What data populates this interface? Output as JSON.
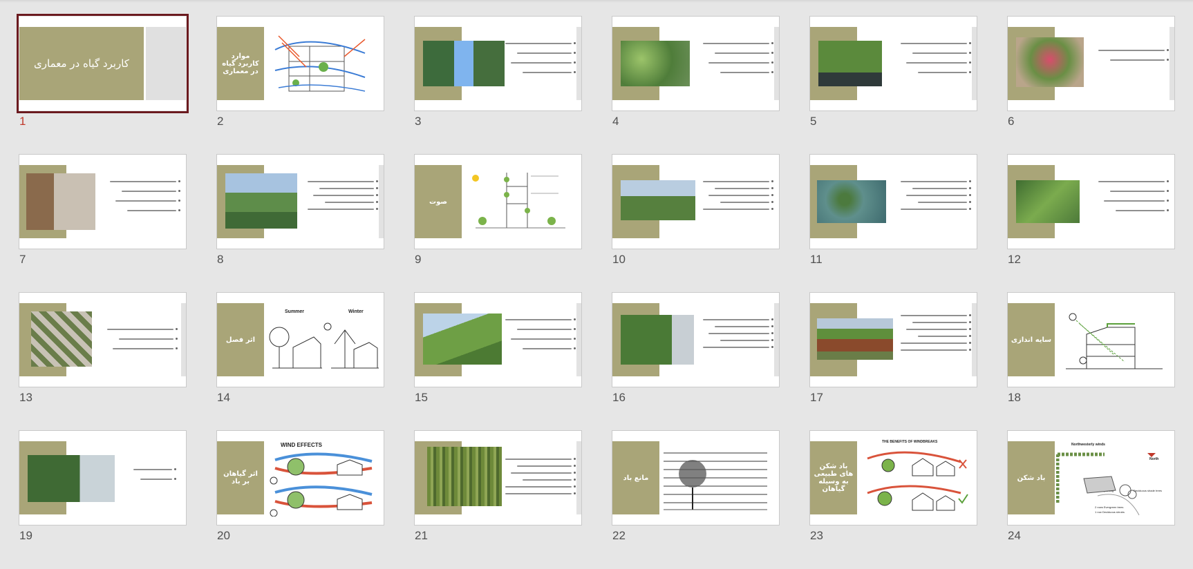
{
  "colors": {
    "olive": "#a9a578",
    "selection_border": "#6b1a1f",
    "selected_number": "#c0392b",
    "background": "#e6e6e6"
  },
  "selected_slide": 1,
  "slides": [
    {
      "number": "1",
      "title": "کاربرد گیاه در معماری",
      "layout": "title",
      "selected": true
    },
    {
      "number": "2",
      "title": "موارد کاربرد گیاه در معماری",
      "layout": "diagram",
      "image": "building-airflow-diagram"
    },
    {
      "number": "3",
      "title": "",
      "layout": "photo-bullets",
      "image": "vertical-forest-towers"
    },
    {
      "number": "4",
      "title": "",
      "layout": "photo-bullets",
      "image": "aerial-green-campus"
    },
    {
      "number": "5",
      "title": "",
      "layout": "photo-bullets",
      "image": "green-courtyard-pool"
    },
    {
      "number": "6",
      "title": "",
      "layout": "photo-bullets",
      "image": "flower-balcony"
    },
    {
      "number": "7",
      "title": "",
      "layout": "photo-bullets",
      "image": "interior-cactus"
    },
    {
      "number": "8",
      "title": "",
      "layout": "photo-bullets",
      "image": "city-highway-trees"
    },
    {
      "number": "9",
      "title": "صوت",
      "layout": "diagram",
      "image": "vertical-garden-section"
    },
    {
      "number": "10",
      "title": "",
      "layout": "photo-bullets",
      "image": "city-park-skyline"
    },
    {
      "number": "11",
      "title": "",
      "layout": "photo-bullets",
      "image": "tree-infographic"
    },
    {
      "number": "12",
      "title": "",
      "layout": "photo-bullets",
      "image": "green-corridor"
    },
    {
      "number": "13",
      "title": "",
      "layout": "photo-bullets",
      "image": "planter-facade"
    },
    {
      "number": "14",
      "title": "اثر فصل",
      "layout": "diagram",
      "image": "summer-winter-shading",
      "labels": [
        "Summer",
        "Winter"
      ]
    },
    {
      "number": "15",
      "title": "",
      "layout": "photo-bullets",
      "image": "curved-green-wall"
    },
    {
      "number": "16",
      "title": "",
      "layout": "photo-bullets",
      "image": "living-wall"
    },
    {
      "number": "17",
      "title": "",
      "layout": "photo-bullets",
      "image": "green-roof-house"
    },
    {
      "number": "18",
      "title": "سایه اندازی",
      "layout": "diagram",
      "image": "shading-section"
    },
    {
      "number": "19",
      "title": "",
      "layout": "photo-bullets",
      "image": "terraced-greenery"
    },
    {
      "number": "20",
      "title": "اثر گیاهان بر باد",
      "layout": "diagram",
      "image": "wind-effects",
      "labels": [
        "WIND EFFECTS"
      ]
    },
    {
      "number": "21",
      "title": "",
      "layout": "photo-bullets",
      "image": "hanging-vines-facade"
    },
    {
      "number": "22",
      "title": "مانع باد",
      "layout": "diagram",
      "image": "windbreak-tree"
    },
    {
      "number": "23",
      "title": "باد شکن های طبیعی به وسیله گیاهان",
      "layout": "diagram",
      "image": "windbreak-benefits",
      "labels": [
        "THE BENEFITS OF WINDBREAKS"
      ]
    },
    {
      "number": "24",
      "title": "باد شکن",
      "layout": "diagram",
      "image": "windbreak-plan",
      "labels": [
        "Northwesterly winds",
        "North",
        "Foundation planting",
        "Deciduous shade trees",
        "2 rows Evergreen trees",
        "1 row Deciduous shrubs"
      ]
    }
  ]
}
